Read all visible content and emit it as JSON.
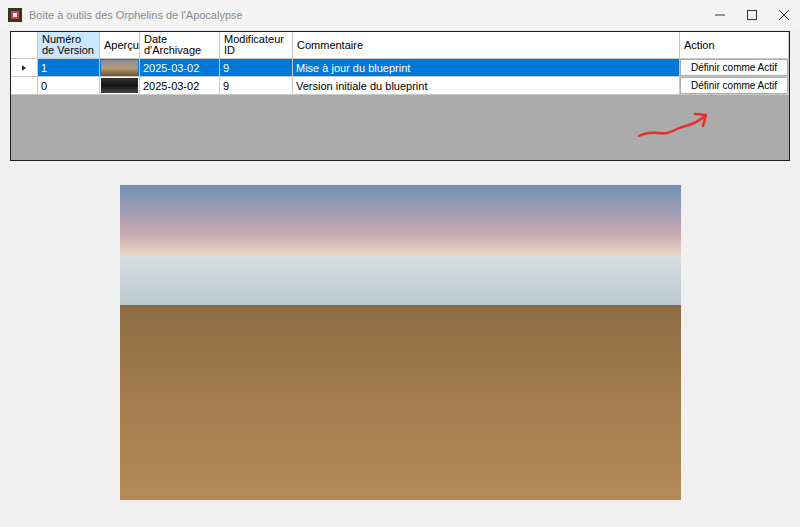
{
  "window": {
    "title": "Boite à outils des Orphelins de l'Apocalypse"
  },
  "table": {
    "columns": [
      {
        "label": "",
        "selected": false
      },
      {
        "label": "Numéro de Version",
        "selected": true
      },
      {
        "label": "Aperçu",
        "selected": false
      },
      {
        "label": "Date d'Archivage",
        "selected": false
      },
      {
        "label": "Modificateur ID",
        "selected": false
      },
      {
        "label": "Commentaire",
        "selected": false
      },
      {
        "label": "Action",
        "selected": false
      }
    ],
    "rows": [
      {
        "version": "1",
        "date": "2025-03-02",
        "modifier": "9",
        "comment": "Mise à jour du blueprint",
        "action": "Définir comme Actif",
        "selected": true,
        "current": true
      },
      {
        "version": "0",
        "date": "2025-03-02",
        "modifier": "9",
        "comment": "Version initiale du blueprint",
        "action": "Définir comme Actif",
        "selected": false,
        "current": false
      }
    ]
  }
}
